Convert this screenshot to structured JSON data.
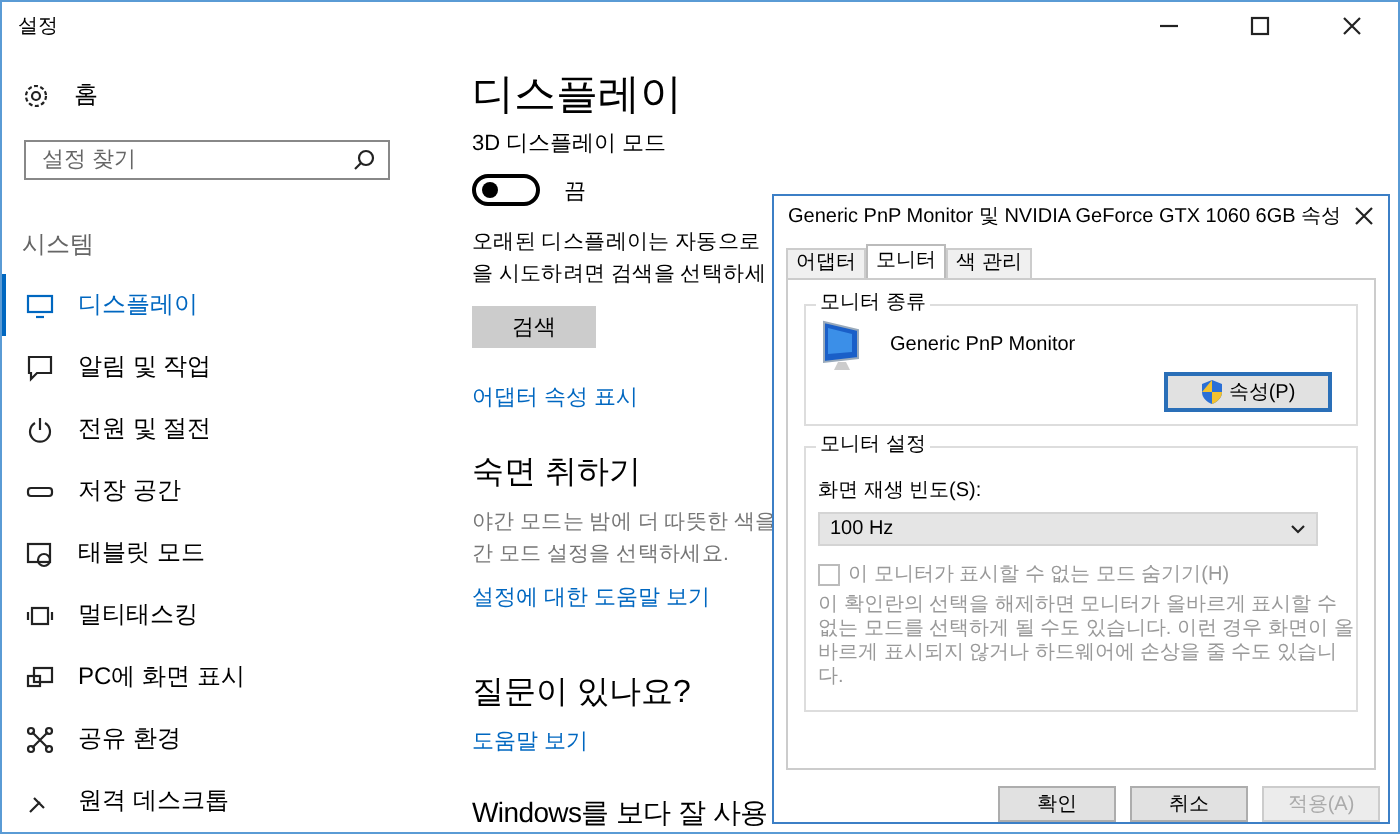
{
  "window": {
    "title": "설정"
  },
  "sidebar": {
    "home": "홈",
    "search_placeholder": "설정 찾기",
    "section": "시스템",
    "items": [
      {
        "label": "디스플레이",
        "selected": true
      },
      {
        "label": "알림 및 작업",
        "selected": false
      },
      {
        "label": "전원 및 절전",
        "selected": false
      },
      {
        "label": "저장 공간",
        "selected": false
      },
      {
        "label": "태블릿 모드",
        "selected": false
      },
      {
        "label": "멀티태스킹",
        "selected": false
      },
      {
        "label": "PC에 화면 표시",
        "selected": false
      },
      {
        "label": "공유 환경",
        "selected": false
      },
      {
        "label": "원격 데스크톱",
        "selected": false
      }
    ]
  },
  "main": {
    "title": "디스플레이",
    "toggle": {
      "label": "3D 디스플레이 모드",
      "on": false,
      "state_text": "끔"
    },
    "description": [
      "오래된 디스플레이는 자동으로",
      "을 시도하려면 검색을 선택하세"
    ],
    "button": "검색",
    "link": "어댑터 속성 표시",
    "night": {
      "title": "숙면 취하기",
      "lines": [
        "야간 모드는 밤에 더 따뜻한 색을",
        "간 모드 설정을 선택하세요."
      ],
      "link": "설정에 대한 도움말 보기"
    },
    "questions": {
      "title": "질문이 있나요?",
      "link": "도움말 보기"
    },
    "bottom_heading": "Windows를 보다 잘 사용"
  },
  "dialog": {
    "title": "Generic PnP Monitor 및 NVIDIA GeForce GTX 1060 6GB 속성",
    "tabs": [
      {
        "label": "어댑터",
        "selected": false
      },
      {
        "label": "모니터",
        "selected": true
      },
      {
        "label": "색 관리",
        "selected": false
      }
    ],
    "monitor_type": {
      "legend": "모니터 종류",
      "name": "Generic PnP Monitor",
      "button": "속성(P)"
    },
    "monitor_settings": {
      "legend": "모니터 설정",
      "refresh_label": "화면 재생 빈도(S):",
      "refresh_value": "100 Hz",
      "hide_modes": {
        "label": "이 모니터가 표시할 수 없는 모드 숨기기(H)",
        "checked": false,
        "disabled": true
      },
      "note": "이 확인란의 선택을 해제하면 모니터가 올바르게 표시할 수 없는 모드를 선택하게 될 수도 있습니다. 이런 경우 화면이 올바르게 표시되지 않거나 하드웨어에 손상을 줄 수도 있습니다."
    },
    "buttons": [
      {
        "label": "확인",
        "disabled": false
      },
      {
        "label": "취소",
        "disabled": false
      },
      {
        "label": "적용(A)",
        "disabled": true
      }
    ]
  }
}
